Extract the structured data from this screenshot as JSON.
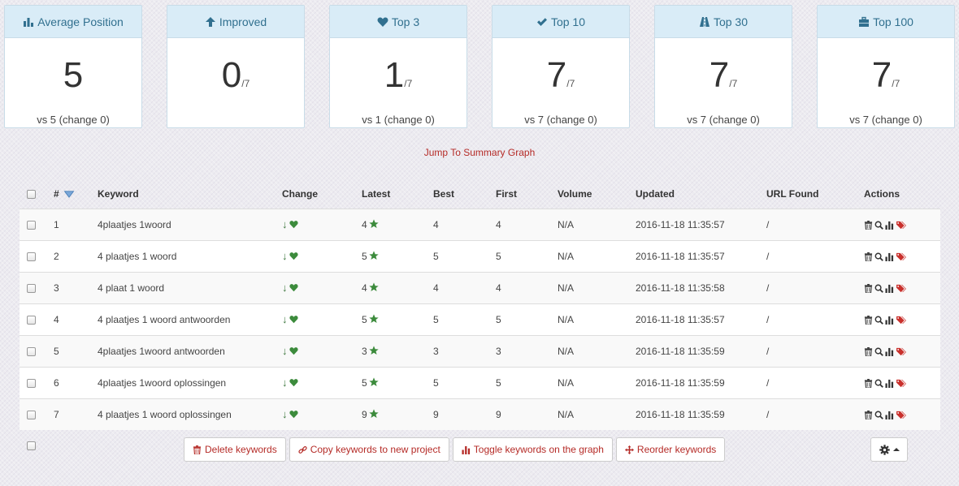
{
  "cards": [
    {
      "label": "Average Position",
      "value": "5",
      "total": "",
      "vs": "vs 5 (change 0)",
      "icon": "bar-chart-icon"
    },
    {
      "label": "Improved",
      "value": "0",
      "total": "/7",
      "vs": "",
      "icon": "arrow-up-icon"
    },
    {
      "label": "Top 3",
      "value": "1",
      "total": "/7",
      "vs": "vs 1 (change 0)",
      "icon": "heart-icon"
    },
    {
      "label": "Top 10",
      "value": "7",
      "total": "/7",
      "vs": "vs 7 (change 0)",
      "icon": "check-icon"
    },
    {
      "label": "Top 30",
      "value": "7",
      "total": "/7",
      "vs": "vs 7 (change 0)",
      "icon": "road-icon"
    },
    {
      "label": "Top 100",
      "value": "7",
      "total": "/7",
      "vs": "vs 7 (change 0)",
      "icon": "briefcase-icon"
    }
  ],
  "jump_link": "Jump To Summary Graph",
  "table": {
    "headers": {
      "num": "#",
      "keyword": "Keyword",
      "change": "Change",
      "latest": "Latest",
      "best": "Best",
      "first": "First",
      "volume": "Volume",
      "updated": "Updated",
      "url": "URL Found",
      "actions": "Actions"
    },
    "change_symbol": "↓",
    "rows": [
      {
        "num": "1",
        "keyword": "4plaatjes 1woord",
        "latest": "4",
        "best": "4",
        "first": "4",
        "volume": "N/A",
        "updated": "2016-11-18 11:35:57",
        "url": "/"
      },
      {
        "num": "2",
        "keyword": "4 plaatjes 1 woord",
        "latest": "5",
        "best": "5",
        "first": "5",
        "volume": "N/A",
        "updated": "2016-11-18 11:35:57",
        "url": "/"
      },
      {
        "num": "3",
        "keyword": "4 plaat 1 woord",
        "latest": "4",
        "best": "4",
        "first": "4",
        "volume": "N/A",
        "updated": "2016-11-18 11:35:58",
        "url": "/"
      },
      {
        "num": "4",
        "keyword": "4 plaatjes 1 woord antwoorden",
        "latest": "5",
        "best": "5",
        "first": "5",
        "volume": "N/A",
        "updated": "2016-11-18 11:35:57",
        "url": "/"
      },
      {
        "num": "5",
        "keyword": "4plaatjes 1woord antwoorden",
        "latest": "3",
        "best": "3",
        "first": "3",
        "volume": "N/A",
        "updated": "2016-11-18 11:35:59",
        "url": "/"
      },
      {
        "num": "6",
        "keyword": "4plaatjes 1woord oplossingen",
        "latest": "5",
        "best": "5",
        "first": "5",
        "volume": "N/A",
        "updated": "2016-11-18 11:35:59",
        "url": "/"
      },
      {
        "num": "7",
        "keyword": "4 plaatjes 1 woord oplossingen",
        "latest": "9",
        "best": "9",
        "first": "9",
        "volume": "N/A",
        "updated": "2016-11-18 11:35:59",
        "url": "/"
      }
    ]
  },
  "buttons": {
    "delete": "Delete keywords",
    "copy": "Copy keywords to new project",
    "toggle": "Toggle keywords on the graph",
    "reorder": "Reorder keywords"
  },
  "colors": {
    "accent_red": "#b52b27",
    "header_blue": "#31708f",
    "card_head_bg": "#d9ecf7",
    "green": "#3c8b3c"
  }
}
